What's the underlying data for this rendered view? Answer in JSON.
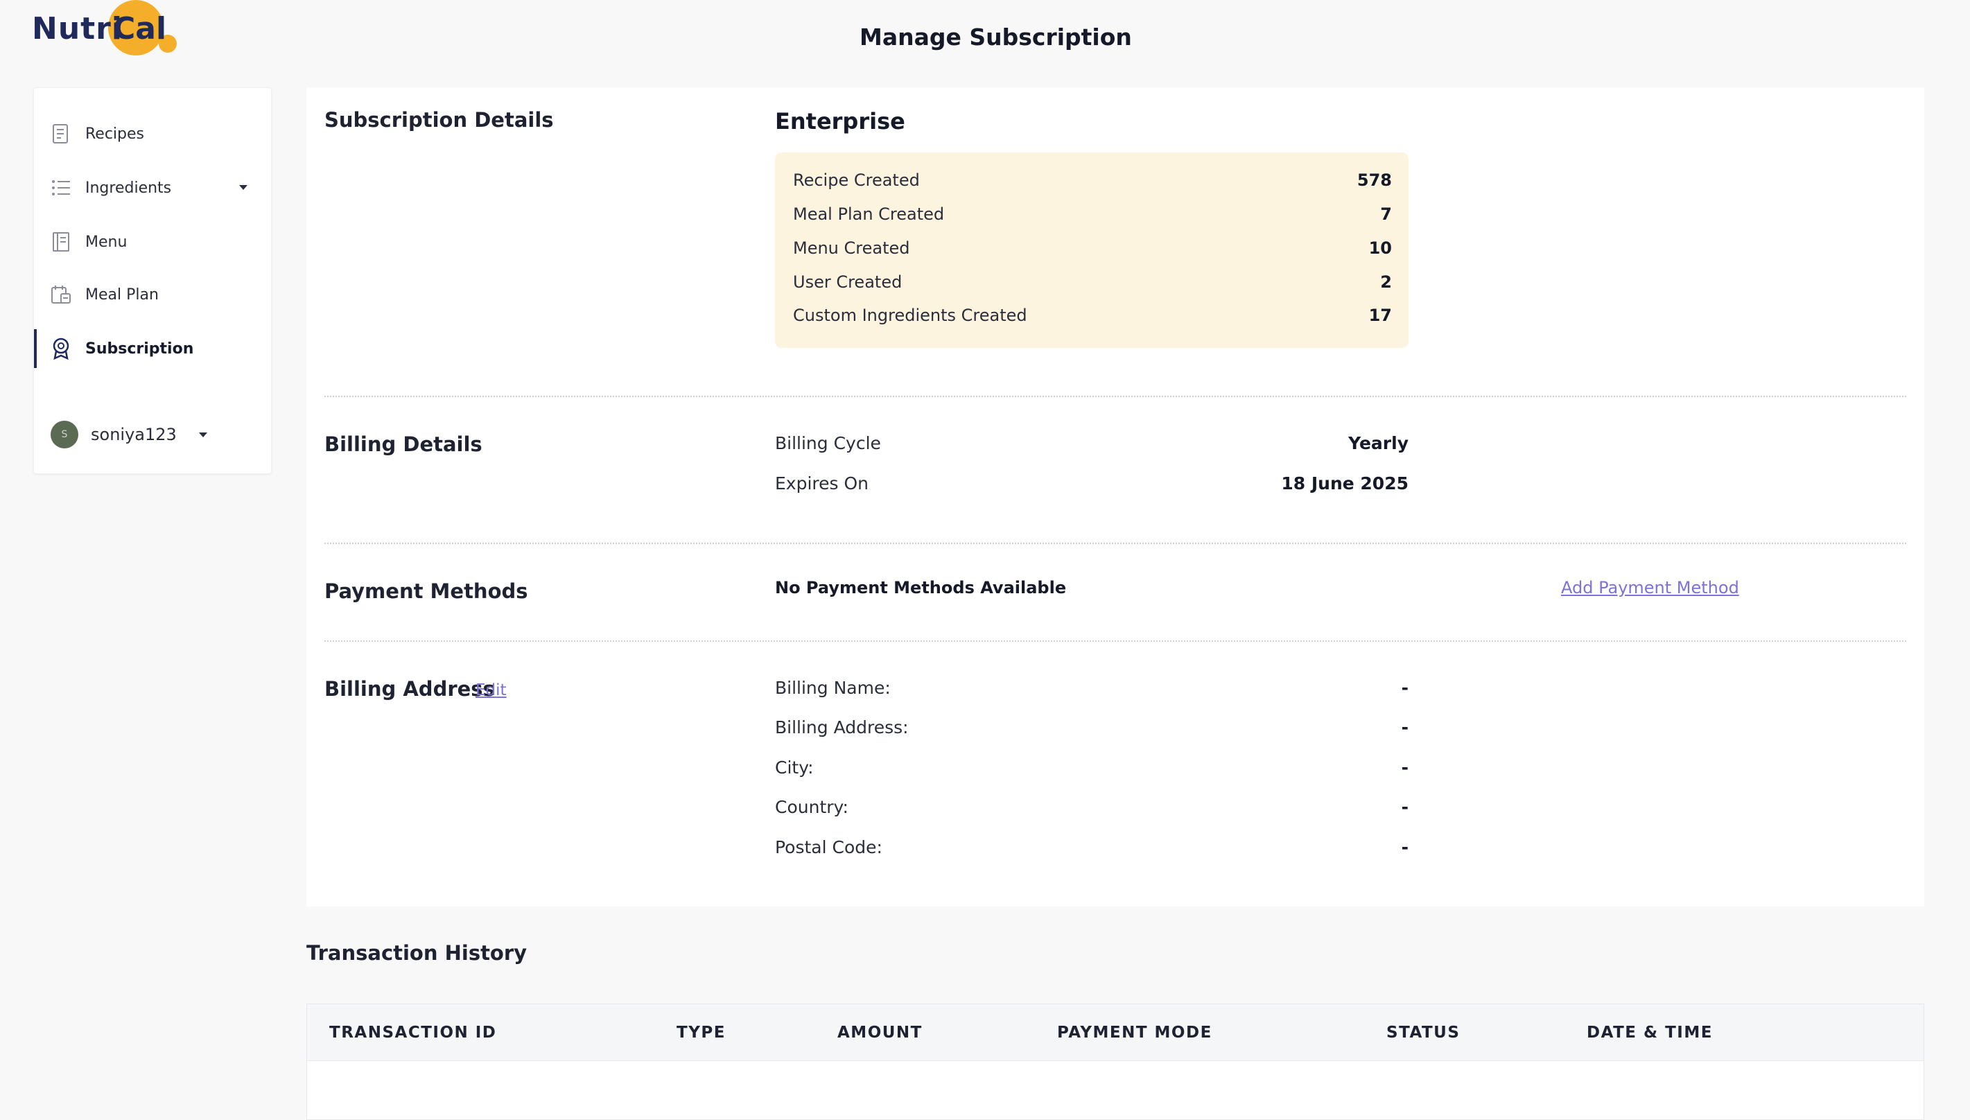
{
  "logo": {
    "part1": "Nutri",
    "part2": "Cal"
  },
  "header": {
    "title": "Manage Subscription"
  },
  "sidebar": {
    "items": [
      {
        "label": "Recipes"
      },
      {
        "label": "Ingredients"
      },
      {
        "label": "Menu"
      },
      {
        "label": "Meal Plan"
      },
      {
        "label": "Subscription"
      }
    ],
    "user": {
      "initial": "S",
      "name": "soniya123"
    }
  },
  "subscription": {
    "section_title": "Subscription Details",
    "plan": "Enterprise",
    "usage": [
      {
        "label": "Recipe Created",
        "value": "578"
      },
      {
        "label": "Meal Plan Created",
        "value": "7"
      },
      {
        "label": "Menu Created",
        "value": "10"
      },
      {
        "label": "User Created",
        "value": "2"
      },
      {
        "label": "Custom Ingredients Created",
        "value": "17"
      }
    ]
  },
  "billing": {
    "section_title": "Billing Details",
    "rows": [
      {
        "label": "Billing Cycle",
        "value": "Yearly"
      },
      {
        "label": "Expires On",
        "value": "18 June 2025"
      }
    ]
  },
  "payment": {
    "section_title": "Payment Methods",
    "empty_text": "No Payment Methods Available",
    "add_label": "Add Payment Method"
  },
  "address": {
    "section_title": "Billing Address",
    "edit_label": "Edit",
    "rows": [
      {
        "label": "Billing Name:",
        "value": "-"
      },
      {
        "label": "Billing Address:",
        "value": "-"
      },
      {
        "label": "City:",
        "value": "-"
      },
      {
        "label": "Country:",
        "value": "-"
      },
      {
        "label": "Postal Code:",
        "value": "-"
      }
    ]
  },
  "transactions": {
    "title": "Transaction History",
    "columns": [
      "TRANSACTION ID",
      "TYPE",
      "AMOUNT",
      "PAYMENT MODE",
      "STATUS",
      "DATE & TIME"
    ]
  },
  "colors": {
    "brand_navy": "#1f2a5a",
    "brand_orange": "#f4ae2a",
    "link": "#7c72d9",
    "usage_bg": "#fdf4e0"
  }
}
